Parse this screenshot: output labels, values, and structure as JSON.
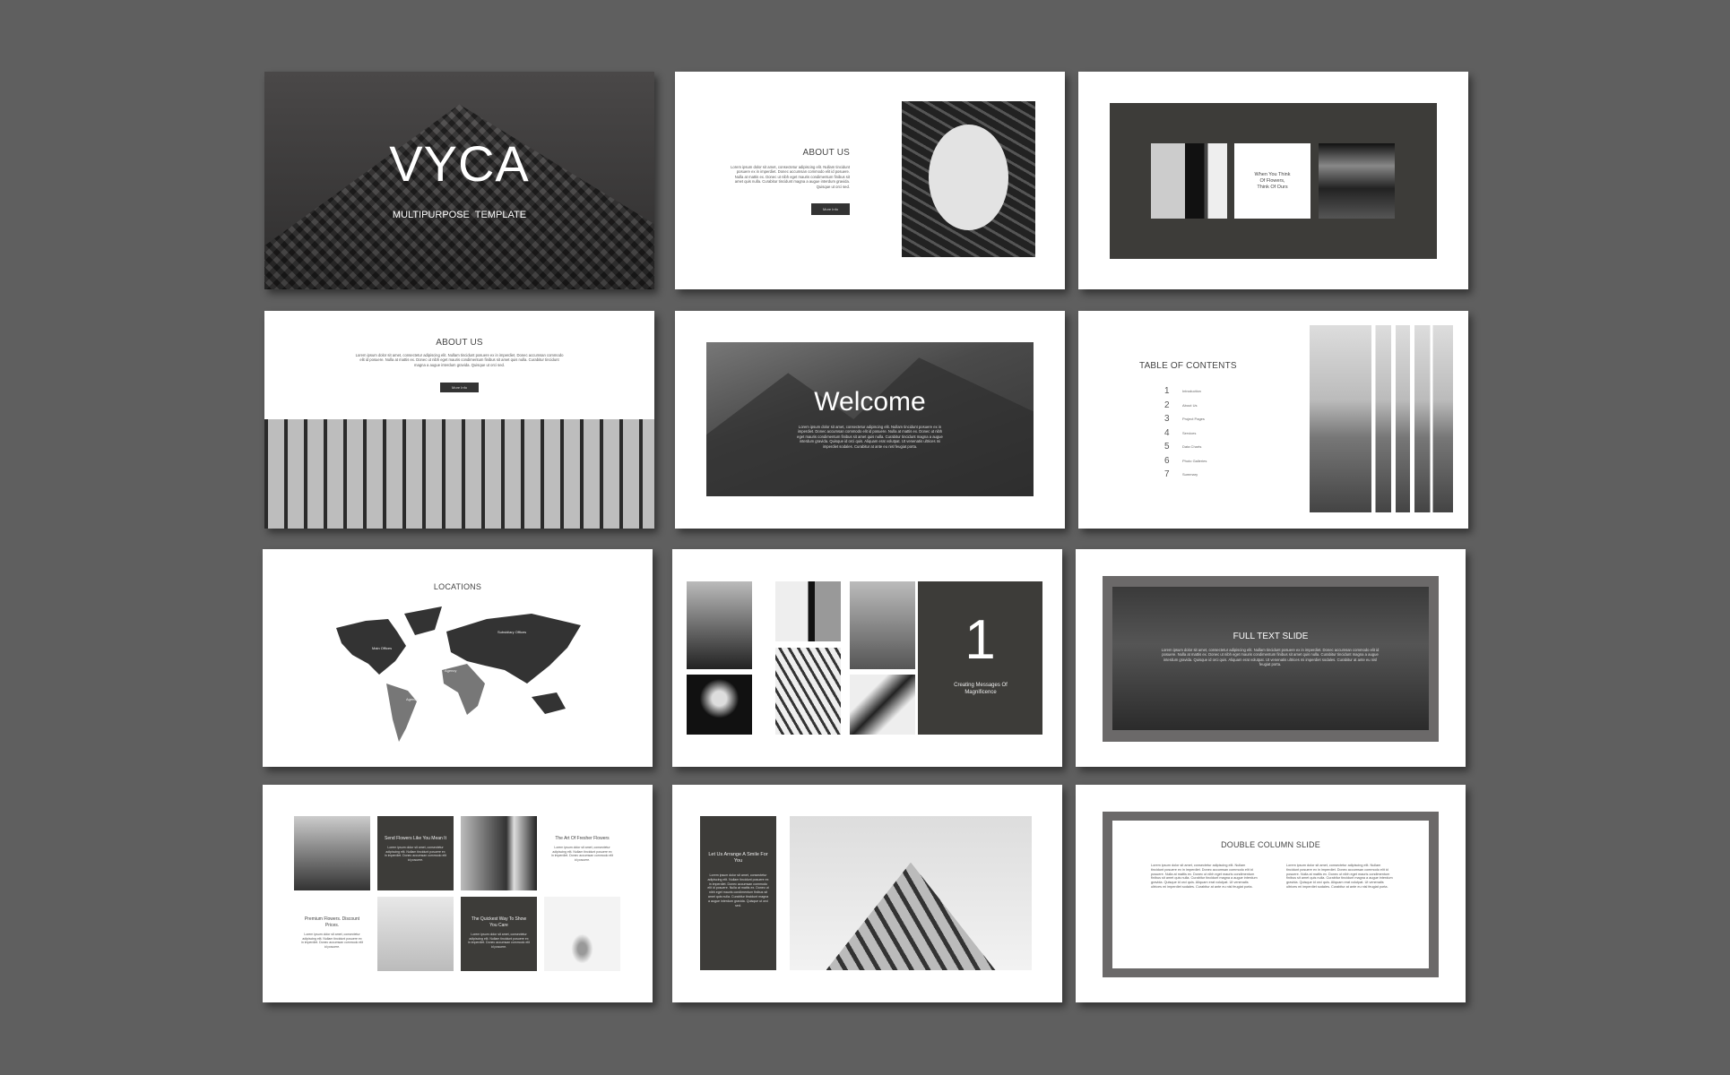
{
  "colors": {
    "background": "#5f5f5f",
    "panel": "#3d3c39",
    "frame": "#6b6969"
  },
  "lorem_short": "Lorem ipsum dolor sit amet, consectetur adipiscing elit. Nullam tincidunt posuere ex in imperdiet. Donec accumsan commodo elit id posuere. Nulla at mattis ex. Donec ut nibh eget mauris condimentum finibus sit amet quis nulla. Curabitur tincidunt magna a augue interdum gravida. Quisque ut orci sed.",
  "lorem_long": "Lorem ipsum dolor sit amet, consectetur adipiscing elit. Nullam tincidunt posuere ex in imperdiet. Donec accumsan commodo elit id posuere. Nulla at mattis ex. Donec ut nibh eget mauris condimentum finibus sit amet quis nulla. Curabitur tincidunt magna a augue interdum gravida. Quisque id orci quis. Aliquam erat volutpat. Ut venenatis ultrices mi imperdiet sodales. Curabitur at ante eu nisl feugiat porta.",
  "lorem_tiny": "Lorem ipsum dolor sit amet, consectetur adipiscing elit. Nullam tincidunt posuere ex in imperdiet. Donec accumsan commodo elit id posuere.",
  "slides": {
    "cover": {
      "title": "VYCA",
      "subtitle": "MULTIPURPOSE  TEMPLATE"
    },
    "about1": {
      "title": "ABOUT US",
      "button": "More Info"
    },
    "flowers": {
      "text": "When You Think Of Flowers, Think Of Ours"
    },
    "about2": {
      "title": "ABOUT US",
      "button": "More Info"
    },
    "welcome": {
      "title": "Welcome"
    },
    "toc": {
      "title": "TABLE OF CONTENTS",
      "items": [
        {
          "num": "1",
          "label": "Introduction"
        },
        {
          "num": "2",
          "label": "About Us"
        },
        {
          "num": "3",
          "label": "Project Pages"
        },
        {
          "num": "4",
          "label": "Services"
        },
        {
          "num": "5",
          "label": "Data Charts"
        },
        {
          "num": "6",
          "label": "Photo Galleries"
        },
        {
          "num": "7",
          "label": "Summary"
        }
      ]
    },
    "locations": {
      "title": "LOCATIONS",
      "main": "Main Offices",
      "subsidiary": "Subsidiary Offices",
      "agency1": "Agency",
      "agency2": "Agency"
    },
    "section": {
      "number": "1",
      "caption": "Creating Messages Of Magnificence"
    },
    "fulltext": {
      "title": "FULL TEXT SLIDE"
    },
    "gallery": {
      "t1": "Send Flowers Like You Mean It",
      "t2": "The Art Of Fresher Flowers",
      "t3": "Premium Flowers. Discount Prices.",
      "t4": "The Quickest Way To Show You Care"
    },
    "arrange": {
      "title": "Let Us Arrange A Smile For You"
    },
    "double": {
      "title": "DOUBLE COLUMN SLIDE"
    }
  }
}
